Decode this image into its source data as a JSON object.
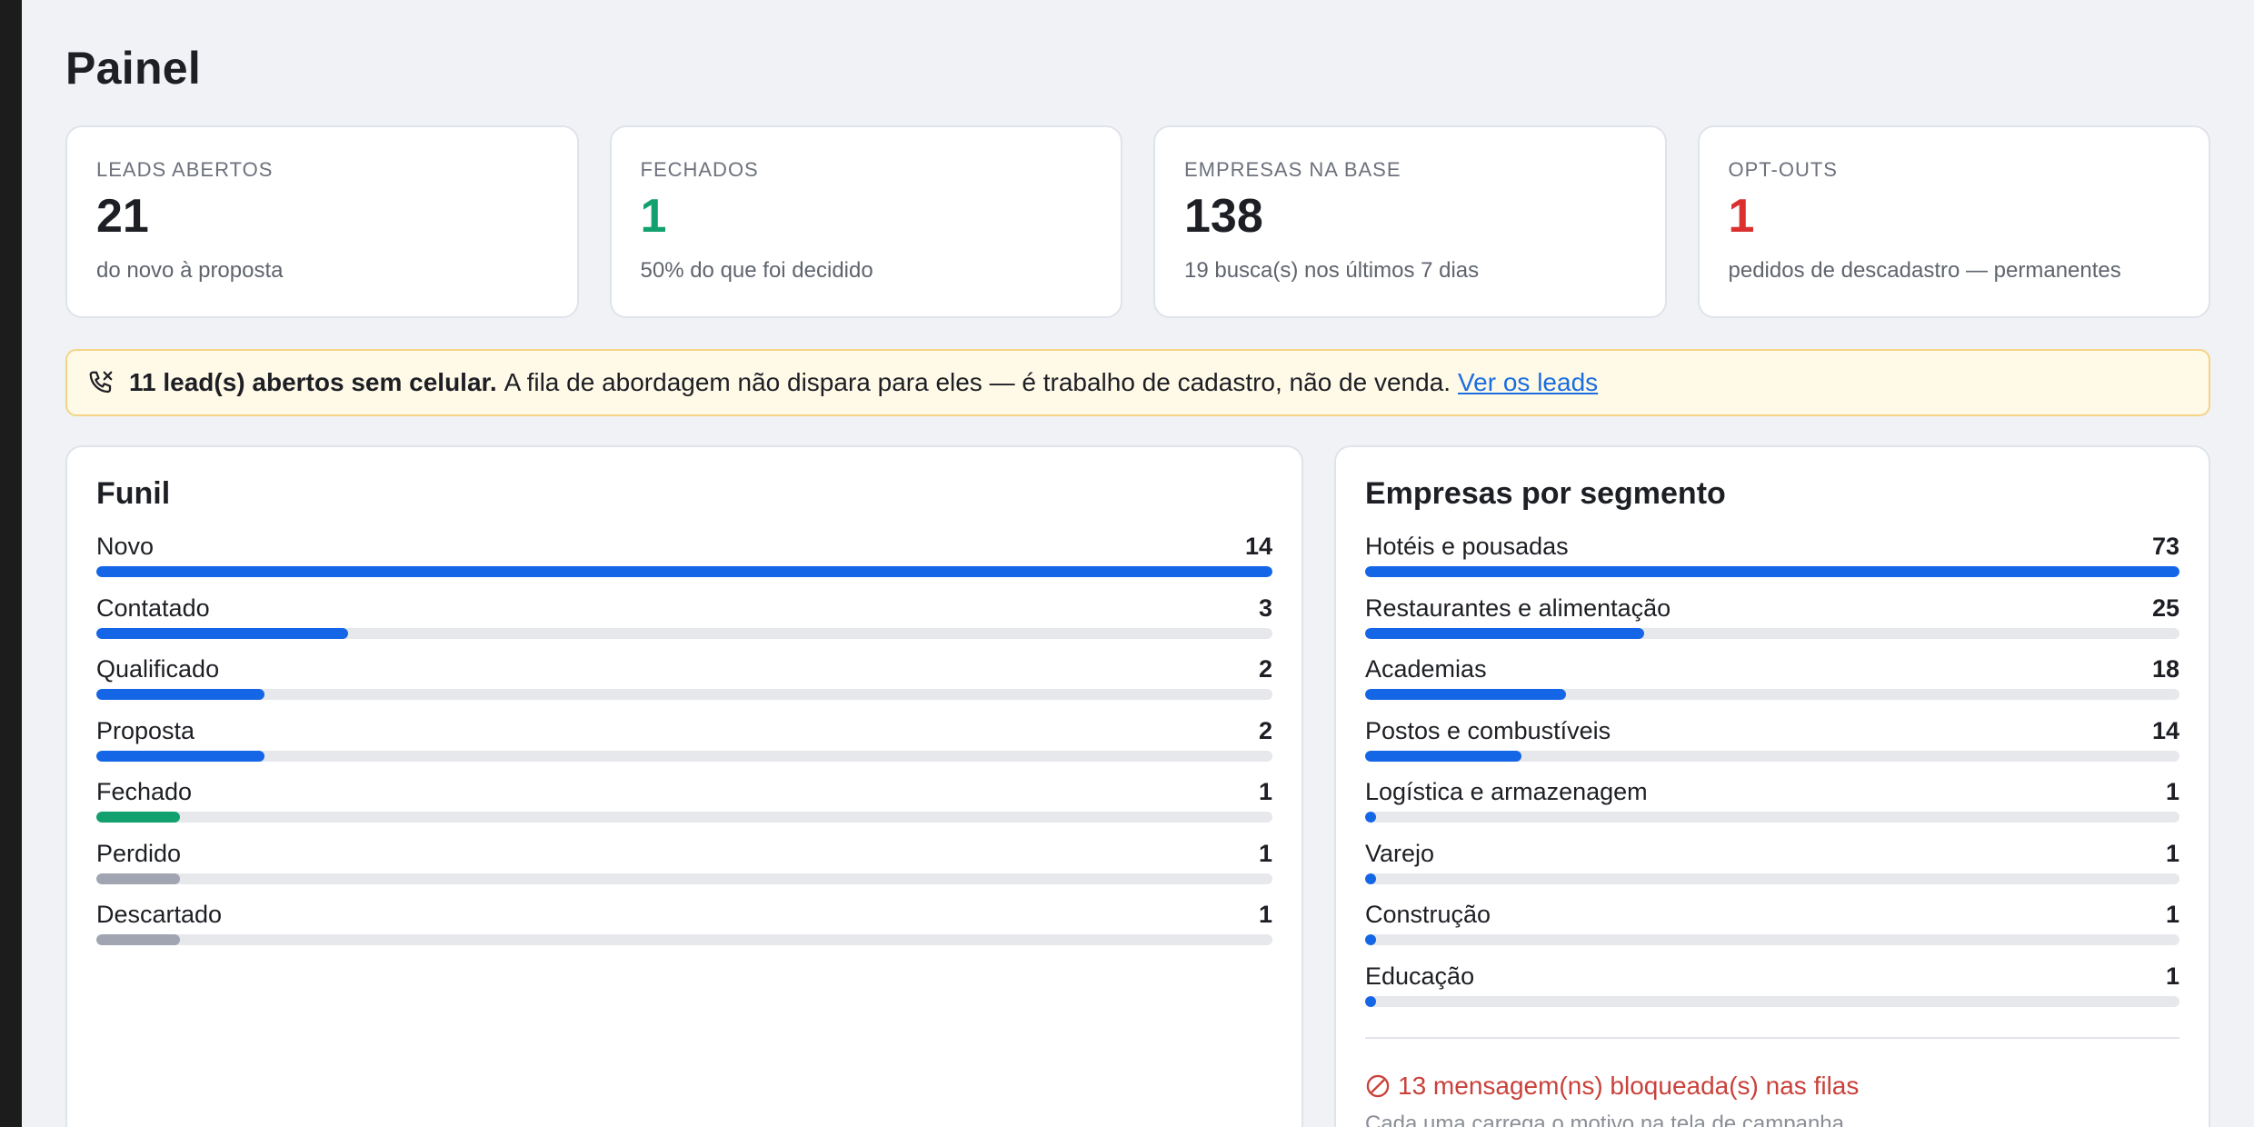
{
  "page": {
    "title": "Painel"
  },
  "cards": [
    {
      "label": "LEADS ABERTOS",
      "value": "21",
      "sub": "do novo à proposta",
      "color": "default"
    },
    {
      "label": "FECHADOS",
      "value": "1",
      "sub": "50% do que foi decidido",
      "color": "green"
    },
    {
      "label": "EMPRESAS NA BASE",
      "value": "138",
      "sub": "19 busca(s) nos últimos 7 dias",
      "color": "default"
    },
    {
      "label": "OPT-OUTS",
      "value": "1",
      "sub": "pedidos de descadastro — permanentes",
      "color": "red"
    }
  ],
  "alert": {
    "icon": "phone-off-icon",
    "bold": "11 lead(s) abertos sem celular.",
    "message": "A fila de abordagem não dispara para eles — é trabalho de cadastro, não de venda.",
    "link": "Ver os leads"
  },
  "funnel": {
    "title": "Funil",
    "max": 14,
    "items": [
      {
        "label": "Novo",
        "count": 14,
        "color": "#1466e6"
      },
      {
        "label": "Contatado",
        "count": 3,
        "color": "#1466e6"
      },
      {
        "label": "Qualificado",
        "count": 2,
        "color": "#1466e6"
      },
      {
        "label": "Proposta",
        "count": 2,
        "color": "#1466e6"
      },
      {
        "label": "Fechado",
        "count": 1,
        "color": "#12a06e"
      },
      {
        "label": "Perdido",
        "count": 1,
        "color": "#a0a5b1"
      },
      {
        "label": "Descartado",
        "count": 1,
        "color": "#a0a5b1"
      }
    ]
  },
  "segments": {
    "title": "Empresas por segmento",
    "max": 73,
    "items": [
      {
        "label": "Hotéis e pousadas",
        "count": 73,
        "color": "#1466e6"
      },
      {
        "label": "Restaurantes e alimentação",
        "count": 25,
        "color": "#1466e6"
      },
      {
        "label": "Academias",
        "count": 18,
        "color": "#1466e6"
      },
      {
        "label": "Postos e combustíveis",
        "count": 14,
        "color": "#1466e6"
      },
      {
        "label": "Logística e armazenagem",
        "count": 1,
        "color": "#1466e6"
      },
      {
        "label": "Varejo",
        "count": 1,
        "color": "#1466e6"
      },
      {
        "label": "Construção",
        "count": 1,
        "color": "#1466e6"
      },
      {
        "label": "Educação",
        "count": 1,
        "color": "#1466e6"
      }
    ],
    "blocked": {
      "icon": "blocked-icon",
      "text": "13 mensagem(ns) bloqueada(s) nas filas",
      "sub": "Cada uma carrega o motivo na tela de campanha."
    }
  }
}
